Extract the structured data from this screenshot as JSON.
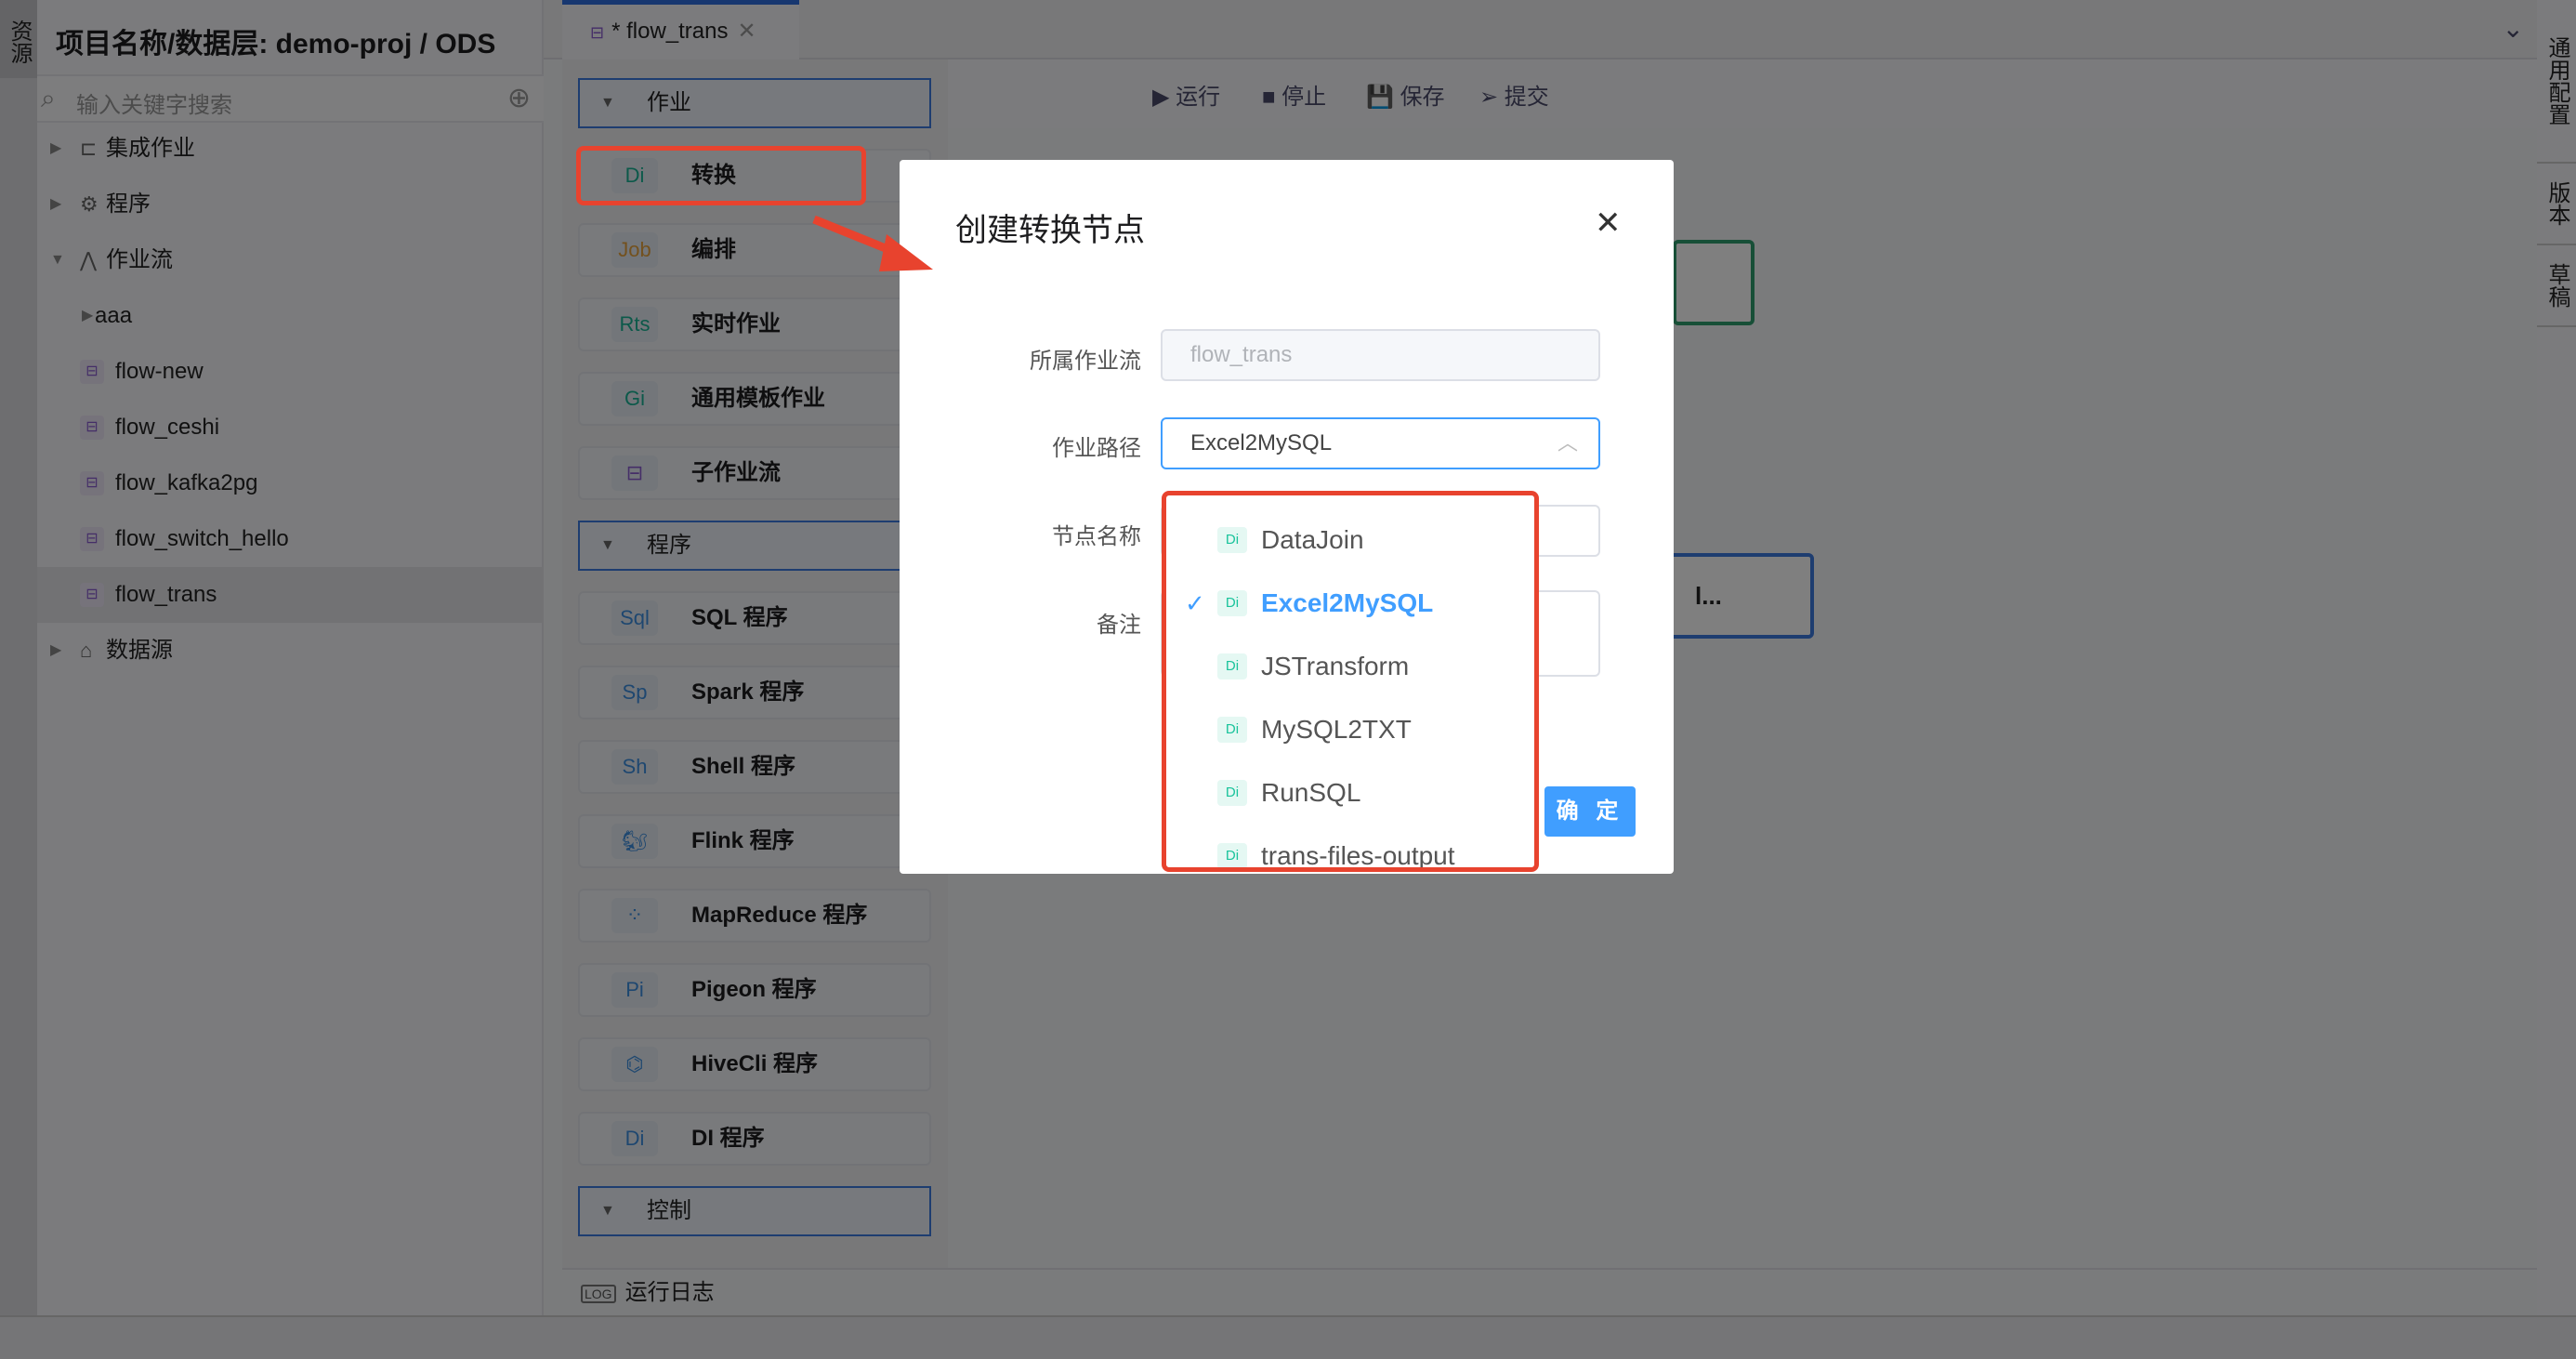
{
  "left_strip": {
    "label": "资源"
  },
  "sidebar": {
    "project_title": "项目名称/数据层:  demo-proj / ODS",
    "search_placeholder": "输入关键字搜索",
    "items": [
      {
        "label": "集成作业",
        "type": "folder",
        "icon": "integration-icon",
        "depth": 0,
        "expanded": false
      },
      {
        "label": "程序",
        "type": "folder",
        "icon": "gear-icon",
        "depth": 0,
        "expanded": false
      },
      {
        "label": "作业流",
        "type": "folder",
        "icon": "workflow-icon",
        "depth": 0,
        "expanded": true
      },
      {
        "label": "aaa",
        "type": "folder",
        "icon": "",
        "depth": 1,
        "expanded": false
      },
      {
        "label": "flow-new",
        "type": "flow",
        "icon": "flow-icon",
        "depth": 1
      },
      {
        "label": "flow_ceshi",
        "type": "flow",
        "icon": "flow-icon",
        "depth": 1
      },
      {
        "label": "flow_kafka2pg",
        "type": "flow",
        "icon": "flow-icon",
        "depth": 1
      },
      {
        "label": "flow_switch_hello",
        "type": "flow",
        "icon": "flow-icon",
        "depth": 1
      },
      {
        "label": "flow_trans",
        "type": "flow",
        "icon": "flow-icon",
        "depth": 1,
        "selected": true
      },
      {
        "label": "数据源",
        "type": "folder",
        "icon": "datasource-icon",
        "depth": 0,
        "expanded": false
      }
    ]
  },
  "tab": {
    "label": "* flow_trans",
    "close": "✕"
  },
  "toolbar": {
    "run": "运行",
    "stop": "停止",
    "save": "保存",
    "submit": "提交"
  },
  "right_strip": [
    "通用配置",
    "版本",
    "草稿"
  ],
  "palette": {
    "sections": [
      {
        "label": "作业",
        "items": [
          {
            "badge": "Di",
            "label": "转换",
            "color": "#19b394"
          },
          {
            "badge": "Job",
            "label": "编排",
            "color": "#e6a23c"
          },
          {
            "badge": "Rts",
            "label": "实时作业",
            "color": "#19b394"
          },
          {
            "badge": "Gi",
            "label": "通用模板作业",
            "color": "#19b394"
          },
          {
            "badge": "⊟",
            "label": "子作业流",
            "color": "#8a5cd0"
          }
        ]
      },
      {
        "label": "程序",
        "items": [
          {
            "badge": "Sql",
            "label": "SQL 程序",
            "color": "#3d8fe0"
          },
          {
            "badge": "Sp",
            "label": "Spark 程序",
            "color": "#3d8fe0"
          },
          {
            "badge": "Sh",
            "label": "Shell 程序",
            "color": "#3d8fe0"
          },
          {
            "badge": "🐿",
            "label": "Flink 程序",
            "color": "#3d8fe0"
          },
          {
            "badge": "⁘",
            "label": "MapReduce 程序",
            "color": "#3d8fe0"
          },
          {
            "badge": "Pi",
            "label": "Pigeon 程序",
            "color": "#3d8fe0"
          },
          {
            "badge": "⌬",
            "label": "HiveCli 程序",
            "color": "#3d8fe0"
          },
          {
            "badge": "Di",
            "label": "DI 程序",
            "color": "#3d8fe0"
          }
        ]
      },
      {
        "label": "控制",
        "items": []
      }
    ]
  },
  "canvas": {
    "blue_node_text": "l..."
  },
  "run_log": {
    "icon": "LOG",
    "label": "运行日志"
  },
  "dialog": {
    "title": "创建转换节点",
    "close": "✕",
    "fields": [
      {
        "label": "所属作业流",
        "value": "flow_trans",
        "disabled": true
      },
      {
        "label": "作业路径",
        "value": "Excel2MySQL"
      },
      {
        "label": "节点名称",
        "value": ""
      },
      {
        "label": "备注",
        "value": ""
      }
    ],
    "confirm": "确 定"
  },
  "dropdown": {
    "options": [
      {
        "badge": "Di",
        "label": "DataJoin"
      },
      {
        "badge": "Di",
        "label": "Excel2MySQL",
        "selected": true
      },
      {
        "badge": "Di",
        "label": "JSTransform"
      },
      {
        "badge": "Di",
        "label": "MySQL2TXT"
      },
      {
        "badge": "Di",
        "label": "RunSQL"
      },
      {
        "badge": "Di",
        "label": "trans-files-output"
      }
    ]
  },
  "colors": {
    "accent": "#409eff",
    "annotation": "#e8432e",
    "section_border": "#3d7be0"
  }
}
